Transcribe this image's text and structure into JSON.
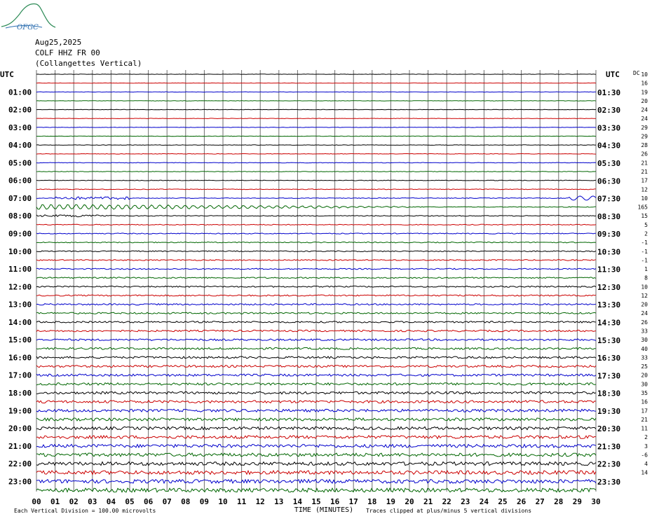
{
  "logo_text": "OFGC",
  "header": {
    "date": "Aug25,2025",
    "station": "COLF HHZ FR 00",
    "location": "(Collangettes Vertical)"
  },
  "chart_data": {
    "type": "line",
    "title": "",
    "left_axis_title": "UTC",
    "right_axis_title": "UTC",
    "dc_label": "DC",
    "xlabel": "TIME (MINUTES)",
    "x_ticks": [
      "00",
      "01",
      "02",
      "03",
      "04",
      "05",
      "06",
      "07",
      "08",
      "09",
      "10",
      "11",
      "12",
      "13",
      "14",
      "15",
      "16",
      "17",
      "18",
      "19",
      "20",
      "21",
      "22",
      "23",
      "24",
      "25",
      "26",
      "27",
      "28",
      "29",
      "30"
    ],
    "xlim": [
      0,
      30
    ],
    "left_hour_labels": [
      "01:00",
      "02:00",
      "03:00",
      "04:00",
      "05:00",
      "06:00",
      "07:00",
      "08:00",
      "09:00",
      "10:00",
      "11:00",
      "12:00",
      "13:00",
      "14:00",
      "15:00",
      "16:00",
      "17:00",
      "18:00",
      "19:00",
      "20:00",
      "21:00",
      "22:00",
      "23:00"
    ],
    "right_hour_labels": [
      "01:30",
      "02:30",
      "03:30",
      "04:30",
      "05:30",
      "06:30",
      "07:30",
      "08:30",
      "09:30",
      "10:30",
      "11:30",
      "12:30",
      "13:30",
      "14:30",
      "15:30",
      "16:30",
      "17:30",
      "18:30",
      "19:30",
      "20:30",
      "21:30",
      "22:30",
      "23:30"
    ],
    "dc_offsets": [
      "10",
      "16",
      "19",
      "20",
      "24",
      "24",
      "29",
      "29",
      "28",
      "26",
      "21",
      "21",
      "17",
      "12",
      "10",
      "165",
      "15",
      "5",
      "2",
      "-1",
      "-1",
      "-1",
      "1",
      "8",
      "10",
      "12",
      "20",
      "24",
      "26",
      "33",
      "30",
      "40",
      "33",
      "25",
      "20",
      "30",
      "35",
      "16",
      "17",
      "21",
      "11",
      "2",
      "3",
      "-6",
      "4",
      "14"
    ],
    "trace_colors": [
      "#000000",
      "#cc0000",
      "#0000cc",
      "#006600"
    ],
    "trace_count": 48,
    "event_trace_index": 14,
    "footer_left": "Each Vertical Division =  100.00 microvolts",
    "footer_right": "Traces clipped at plus/minus 5 vertical divisions"
  }
}
